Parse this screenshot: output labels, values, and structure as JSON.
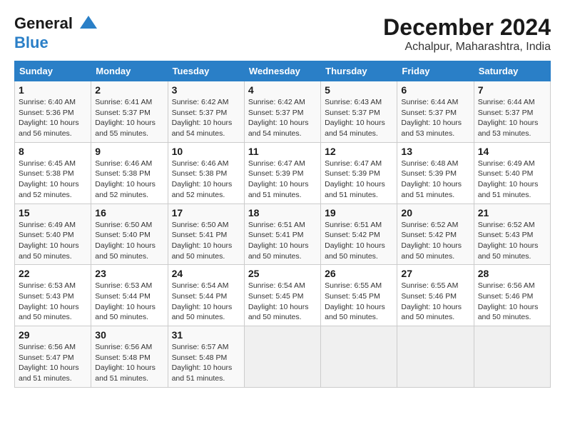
{
  "header": {
    "logo_line1": "General",
    "logo_line2": "Blue",
    "month_title": "December 2024",
    "location": "Achalpur, Maharashtra, India"
  },
  "weekdays": [
    "Sunday",
    "Monday",
    "Tuesday",
    "Wednesday",
    "Thursday",
    "Friday",
    "Saturday"
  ],
  "weeks": [
    [
      {
        "day": "1",
        "sunrise": "6:40 AM",
        "sunset": "5:36 PM",
        "daylight": "10 hours and 56 minutes."
      },
      {
        "day": "2",
        "sunrise": "6:41 AM",
        "sunset": "5:37 PM",
        "daylight": "10 hours and 55 minutes."
      },
      {
        "day": "3",
        "sunrise": "6:42 AM",
        "sunset": "5:37 PM",
        "daylight": "10 hours and 54 minutes."
      },
      {
        "day": "4",
        "sunrise": "6:42 AM",
        "sunset": "5:37 PM",
        "daylight": "10 hours and 54 minutes."
      },
      {
        "day": "5",
        "sunrise": "6:43 AM",
        "sunset": "5:37 PM",
        "daylight": "10 hours and 54 minutes."
      },
      {
        "day": "6",
        "sunrise": "6:44 AM",
        "sunset": "5:37 PM",
        "daylight": "10 hours and 53 minutes."
      },
      {
        "day": "7",
        "sunrise": "6:44 AM",
        "sunset": "5:37 PM",
        "daylight": "10 hours and 53 minutes."
      }
    ],
    [
      {
        "day": "8",
        "sunrise": "6:45 AM",
        "sunset": "5:38 PM",
        "daylight": "10 hours and 52 minutes."
      },
      {
        "day": "9",
        "sunrise": "6:46 AM",
        "sunset": "5:38 PM",
        "daylight": "10 hours and 52 minutes."
      },
      {
        "day": "10",
        "sunrise": "6:46 AM",
        "sunset": "5:38 PM",
        "daylight": "10 hours and 52 minutes."
      },
      {
        "day": "11",
        "sunrise": "6:47 AM",
        "sunset": "5:39 PM",
        "daylight": "10 hours and 51 minutes."
      },
      {
        "day": "12",
        "sunrise": "6:47 AM",
        "sunset": "5:39 PM",
        "daylight": "10 hours and 51 minutes."
      },
      {
        "day": "13",
        "sunrise": "6:48 AM",
        "sunset": "5:39 PM",
        "daylight": "10 hours and 51 minutes."
      },
      {
        "day": "14",
        "sunrise": "6:49 AM",
        "sunset": "5:40 PM",
        "daylight": "10 hours and 51 minutes."
      }
    ],
    [
      {
        "day": "15",
        "sunrise": "6:49 AM",
        "sunset": "5:40 PM",
        "daylight": "10 hours and 50 minutes."
      },
      {
        "day": "16",
        "sunrise": "6:50 AM",
        "sunset": "5:40 PM",
        "daylight": "10 hours and 50 minutes."
      },
      {
        "day": "17",
        "sunrise": "6:50 AM",
        "sunset": "5:41 PM",
        "daylight": "10 hours and 50 minutes."
      },
      {
        "day": "18",
        "sunrise": "6:51 AM",
        "sunset": "5:41 PM",
        "daylight": "10 hours and 50 minutes."
      },
      {
        "day": "19",
        "sunrise": "6:51 AM",
        "sunset": "5:42 PM",
        "daylight": "10 hours and 50 minutes."
      },
      {
        "day": "20",
        "sunrise": "6:52 AM",
        "sunset": "5:42 PM",
        "daylight": "10 hours and 50 minutes."
      },
      {
        "day": "21",
        "sunrise": "6:52 AM",
        "sunset": "5:43 PM",
        "daylight": "10 hours and 50 minutes."
      }
    ],
    [
      {
        "day": "22",
        "sunrise": "6:53 AM",
        "sunset": "5:43 PM",
        "daylight": "10 hours and 50 minutes."
      },
      {
        "day": "23",
        "sunrise": "6:53 AM",
        "sunset": "5:44 PM",
        "daylight": "10 hours and 50 minutes."
      },
      {
        "day": "24",
        "sunrise": "6:54 AM",
        "sunset": "5:44 PM",
        "daylight": "10 hours and 50 minutes."
      },
      {
        "day": "25",
        "sunrise": "6:54 AM",
        "sunset": "5:45 PM",
        "daylight": "10 hours and 50 minutes."
      },
      {
        "day": "26",
        "sunrise": "6:55 AM",
        "sunset": "5:45 PM",
        "daylight": "10 hours and 50 minutes."
      },
      {
        "day": "27",
        "sunrise": "6:55 AM",
        "sunset": "5:46 PM",
        "daylight": "10 hours and 50 minutes."
      },
      {
        "day": "28",
        "sunrise": "6:56 AM",
        "sunset": "5:46 PM",
        "daylight": "10 hours and 50 minutes."
      }
    ],
    [
      {
        "day": "29",
        "sunrise": "6:56 AM",
        "sunset": "5:47 PM",
        "daylight": "10 hours and 51 minutes."
      },
      {
        "day": "30",
        "sunrise": "6:56 AM",
        "sunset": "5:48 PM",
        "daylight": "10 hours and 51 minutes."
      },
      {
        "day": "31",
        "sunrise": "6:57 AM",
        "sunset": "5:48 PM",
        "daylight": "10 hours and 51 minutes."
      },
      null,
      null,
      null,
      null
    ]
  ]
}
